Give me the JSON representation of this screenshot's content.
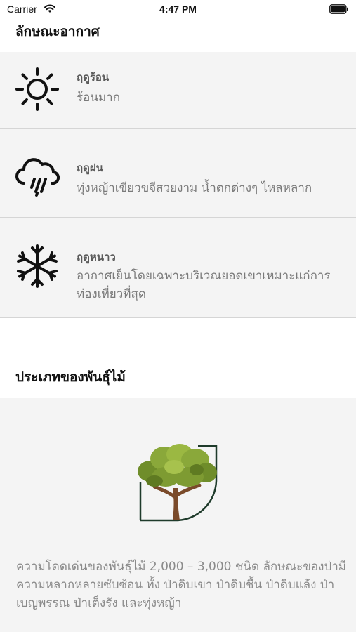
{
  "status_bar": {
    "carrier": "Carrier",
    "time": "4:47 PM",
    "wifi_icon": "wifi-icon",
    "battery_icon": "battery-icon"
  },
  "weather_section": {
    "title": "ลักษณะอากาศ",
    "seasons": [
      {
        "icon": "sun-icon",
        "title": "ฤดูร้อน",
        "description": "ร้อนมาก"
      },
      {
        "icon": "rain-cloud-icon",
        "title": "ฤดูฝน",
        "description": "ทุ่งหญ้าเขียวขจีสวยงาม น้ำตกต่างๆ ไหลหลาก"
      },
      {
        "icon": "snowflake-icon",
        "title": "ฤดูหนาว",
        "description": "อากาศเย็นโดยเฉพาะบริเวณยอดเขาเหมาะแก่การท่องเที่ยวที่สุด"
      }
    ]
  },
  "plant_section": {
    "title": "ประเภทของพันธุ์ไม้",
    "image_icon": "tree-logo",
    "description": "ความโดดเด่นของพันธุ์ไม้ 2,000 – 3,000 ชนิด ลักษณะของป่ามีความหลากหลายซับซ้อน ทั้ง ป่าดิบเขา ป่าดิบชื้น ป่าดิบแล้ง ป่าเบญพรรณ ป่าเต็งรัง และทุ่งหญ้า"
  },
  "colors": {
    "row_background": "#f4f4f4",
    "separator": "#d5d5d5",
    "tree_leaves": "#8aa83a",
    "tree_trunk": "#7a4a2a",
    "logo_frame": "#1f3b2b"
  }
}
